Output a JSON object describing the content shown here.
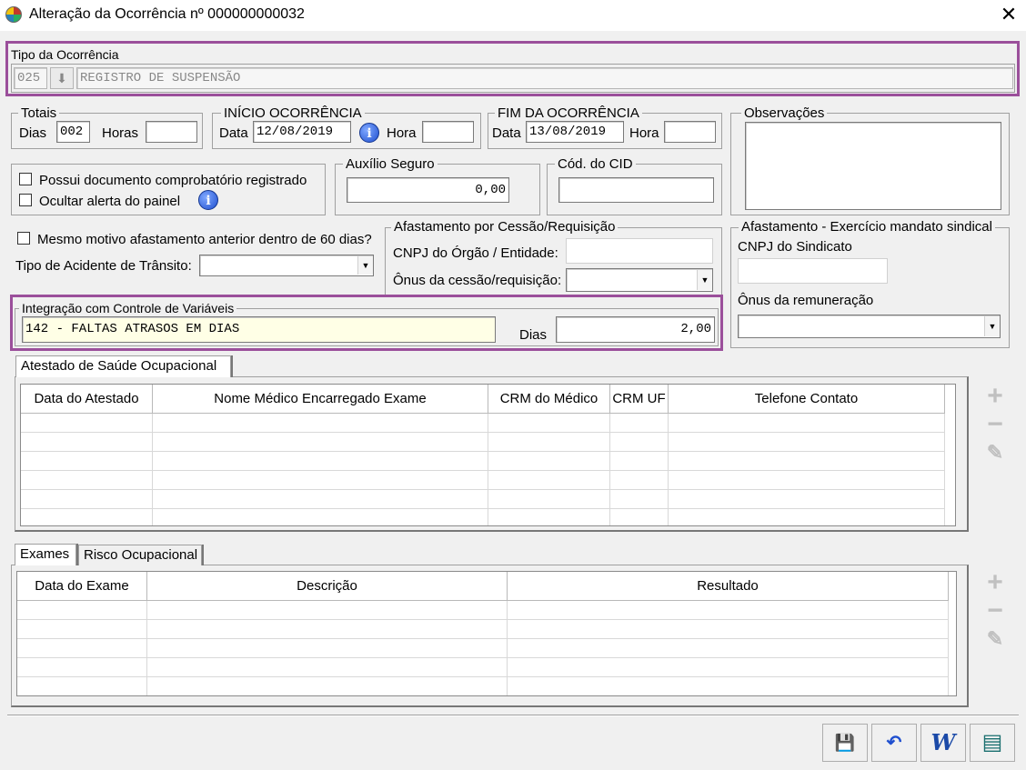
{
  "window": {
    "title": "Alteração da Ocorrência nº 000000000032",
    "close_glyph": "✕"
  },
  "tipo": {
    "legend": "Tipo da Ocorrência",
    "code": "025",
    "description": "REGISTRO DE SUSPENSÃO"
  },
  "totais": {
    "legend": "Totais",
    "dias_label": "Dias",
    "dias_value": "002",
    "horas_label": "Horas",
    "horas_value": ""
  },
  "inicio": {
    "legend": "INÍCIO OCORRÊNCIA",
    "data_label": "Data",
    "data_value": "12/08/2019",
    "hora_label": "Hora",
    "hora_value": ""
  },
  "fim": {
    "legend": "FIM DA OCORRÊNCIA",
    "data_label": "Data",
    "data_value": "13/08/2019",
    "hora_label": "Hora",
    "hora_value": ""
  },
  "observacoes": {
    "legend": "Observações",
    "value": ""
  },
  "checks": {
    "possui_doc": "Possui documento comprobatório registrado",
    "ocultar_alerta": "Ocultar alerta do painel",
    "mesmo_motivo": "Mesmo motivo afastamento anterior dentro de 60 dias?"
  },
  "auxilio": {
    "legend": "Auxílio Seguro",
    "value": "0,00"
  },
  "cid": {
    "legend": "Cód. do CID",
    "value": ""
  },
  "acidente": {
    "label": "Tipo de Acidente de Trânsito:",
    "value": ""
  },
  "cessao": {
    "legend": "Afastamento por Cessão/Requisição",
    "cnpj_label": "CNPJ do Órgão / Entidade:",
    "cnpj_value": "",
    "onus_label": "Ônus da cessão/requisição:",
    "onus_value": ""
  },
  "sindical": {
    "legend": "Afastamento - Exercício mandato sindical",
    "cnpj_label": "CNPJ do Sindicato",
    "cnpj_value": "",
    "onus_label": "Ônus da remuneração",
    "onus_value": ""
  },
  "integracao": {
    "legend": "Integração com Controle de Variáveis",
    "value": "142 - FALTAS ATRASOS EM DIAS",
    "dias_label": "Dias",
    "dias_value": "2,00"
  },
  "atestado": {
    "tab": "Atestado de Saúde Ocupacional",
    "columns": [
      "Data do Atestado",
      "Nome Médico Encarregado Exame",
      "CRM do Médico",
      "CRM UF",
      "Telefone Contato"
    ],
    "rows": [
      [],
      [],
      [],
      [],
      [],
      []
    ]
  },
  "exames": {
    "tabs": [
      "Exames",
      "Risco Ocupacional"
    ],
    "columns": [
      "Data do Exame",
      "Descrição",
      "Resultado"
    ],
    "rows": [
      [],
      [],
      [],
      [],
      []
    ]
  },
  "side_buttons": {
    "add": "+",
    "remove": "−",
    "edit": "✎"
  },
  "toolbar": {
    "save": "💾",
    "undo": "↶",
    "word": "W",
    "report": "▤"
  }
}
